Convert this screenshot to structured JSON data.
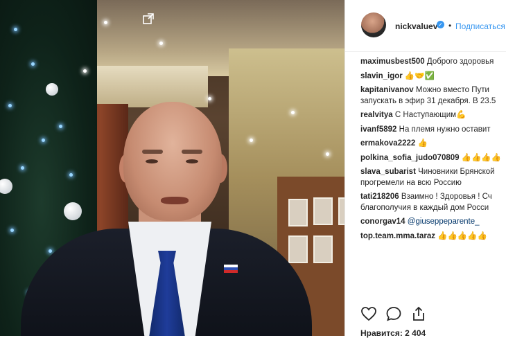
{
  "post": {
    "username": "nickvaluev",
    "verified_mark": "✓",
    "separator": "•",
    "follow_label": "Подписаться",
    "likes_text": "Нравится: 2 404"
  },
  "comments": [
    {
      "user": "maximusbest500",
      "text": " Доброго здоровья",
      "mention": ""
    },
    {
      "user": "slavin_igor",
      "text": " 👍🤝✅",
      "mention": ""
    },
    {
      "user": "kapitanivanov",
      "text": " Можно вместо Пути",
      "mention": "",
      "text2": "запускать в эфир 31 декабря. В 23.5"
    },
    {
      "user": "realvitya",
      "text": " С Наступающим💪",
      "mention": ""
    },
    {
      "user": "ivanf5892",
      "text": " На племя нужно оставит",
      "mention": ""
    },
    {
      "user": "ermakova2222",
      "text": " 👍",
      "mention": ""
    },
    {
      "user": "polkina_sofia_judo070809",
      "text": " 👍👍👍👍",
      "mention": ""
    },
    {
      "user": "slava_subarist",
      "text": " Чиновники Брянской",
      "mention": "",
      "text2": "прогремели на всю Россию"
    },
    {
      "user": "tati218206",
      "text": " Взаимно ! Здоровья ! Сч",
      "mention": "",
      "text2": "благополучия в каждый дом Росси"
    },
    {
      "user": "conorgav14",
      "text": " ",
      "mention": "@giuseppeparente_"
    },
    {
      "user": "top.team.mma.taraz",
      "text": " 👍👍👍👍👍",
      "mention": ""
    }
  ],
  "icons": {
    "like": "heart-icon",
    "comment": "comment-icon",
    "share": "share-icon",
    "expand": "expand-icon"
  },
  "colors": {
    "link": "#3897f0",
    "text": "#262626",
    "mention": "#003569"
  }
}
